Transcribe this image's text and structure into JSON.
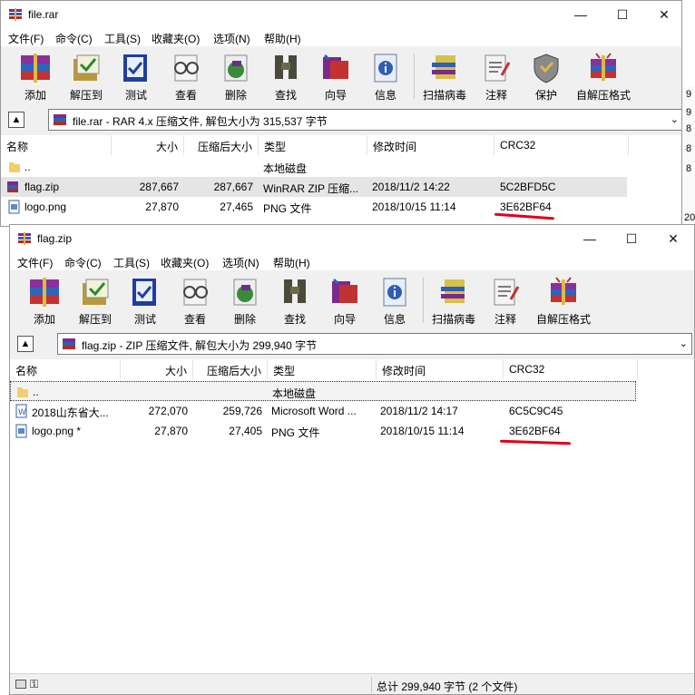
{
  "back_window": {
    "title": "file.rar",
    "menu": [
      "文件(F)",
      "命令(C)",
      "工具(S)",
      "收藏夹(O)",
      "选项(N)",
      "帮助(H)"
    ],
    "toolbar": [
      "添加",
      "解压到",
      "测试",
      "查看",
      "删除",
      "查找",
      "向导",
      "信息",
      "扫描病毒",
      "注释",
      "保护",
      "自解压格式"
    ],
    "address": "file.rar - RAR 4.x 压缩文件, 解包大小为 315,537 字节",
    "columns": [
      "名称",
      "大小",
      "压缩后大小",
      "类型",
      "修改时间",
      "CRC32"
    ],
    "rows": [
      {
        "name": "..",
        "size": "",
        "packed": "",
        "type": "本地磁盘",
        "modified": "",
        "crc": ""
      },
      {
        "name": "flag.zip",
        "size": "287,667",
        "packed": "287,667",
        "type": "WinRAR ZIP 压缩...",
        "modified": "2018/11/2 14:22",
        "crc": "5C2BFD5C"
      },
      {
        "name": "logo.png",
        "size": "27,870",
        "packed": "27,465",
        "type": "PNG 文件",
        "modified": "2018/10/15 11:14",
        "crc": "3E62BF64"
      }
    ],
    "right_edge_fragments": [
      "9",
      "9",
      "8",
      "8",
      "8",
      "20",
      "20"
    ]
  },
  "front_window": {
    "title": "flag.zip",
    "menu": [
      "文件(F)",
      "命令(C)",
      "工具(S)",
      "收藏夹(O)",
      "选项(N)",
      "帮助(H)"
    ],
    "toolbar": [
      "添加",
      "解压到",
      "测试",
      "查看",
      "删除",
      "查找",
      "向导",
      "信息",
      "扫描病毒",
      "注释",
      "自解压格式"
    ],
    "address": "flag.zip - ZIP 压缩文件, 解包大小为 299,940 字节",
    "columns": [
      "名称",
      "大小",
      "压缩后大小",
      "类型",
      "修改时间",
      "CRC32"
    ],
    "rows": [
      {
        "name": "..",
        "size": "",
        "packed": "",
        "type": "本地磁盘",
        "modified": "",
        "crc": ""
      },
      {
        "name": "2018山东省大...",
        "size": "272,070",
        "packed": "259,726",
        "type": "Microsoft Word ...",
        "modified": "2018/11/2 14:17",
        "crc": "6C5C9C45"
      },
      {
        "name": "logo.png *",
        "size": "27,870",
        "packed": "27,405",
        "type": "PNG 文件",
        "modified": "2018/10/15 11:14",
        "crc": "3E62BF64"
      }
    ],
    "status_right": "总计 299,940 字节 (2 个文件)"
  },
  "colors": {
    "highlight_line": "#e0001a",
    "selected_row": "#e5e5e5"
  }
}
